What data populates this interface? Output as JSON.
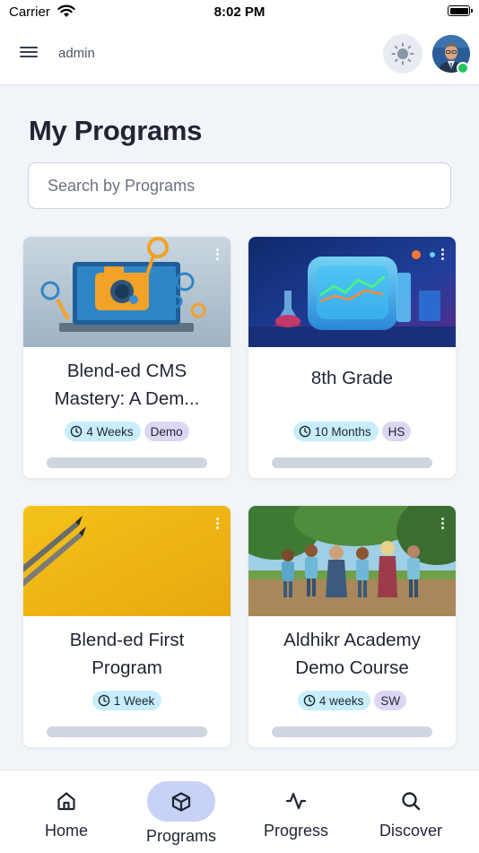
{
  "status_bar": {
    "carrier": "Carrier",
    "time": "8:02 PM"
  },
  "header": {
    "username": "admin",
    "menu_icon": "hamburger-menu-icon",
    "theme_icon": "sun-icon",
    "avatar_online_color": "#22c55e"
  },
  "page": {
    "title": "My Programs",
    "search_placeholder": "Search by Programs"
  },
  "programs": [
    {
      "title": "Blend-ed CMS Mastery: A Dem...",
      "duration": "4 Weeks",
      "tag": "Demo",
      "progress": 0
    },
    {
      "title": "8th Grade",
      "duration": "10 Months",
      "tag": "HS",
      "progress": 0
    },
    {
      "title": "Blend-ed First Program",
      "duration": "1 Week",
      "tag": "",
      "progress": 0
    },
    {
      "title": "Aldhikr Academy Demo Course",
      "duration": "4 weeks",
      "tag": "SW",
      "progress": 0
    }
  ],
  "bottom_nav": [
    {
      "label": "Home",
      "icon": "home-icon",
      "active": false
    },
    {
      "label": "Programs",
      "icon": "cube-icon",
      "active": true
    },
    {
      "label": "Progress",
      "icon": "activity-icon",
      "active": false
    },
    {
      "label": "Discover",
      "icon": "search-icon",
      "active": false
    }
  ],
  "colors": {
    "accent": "#c7d2f6",
    "duration_badge": "#c8eefb",
    "tag_badge": "#ddd6f3",
    "background": "#f1f4f8"
  }
}
